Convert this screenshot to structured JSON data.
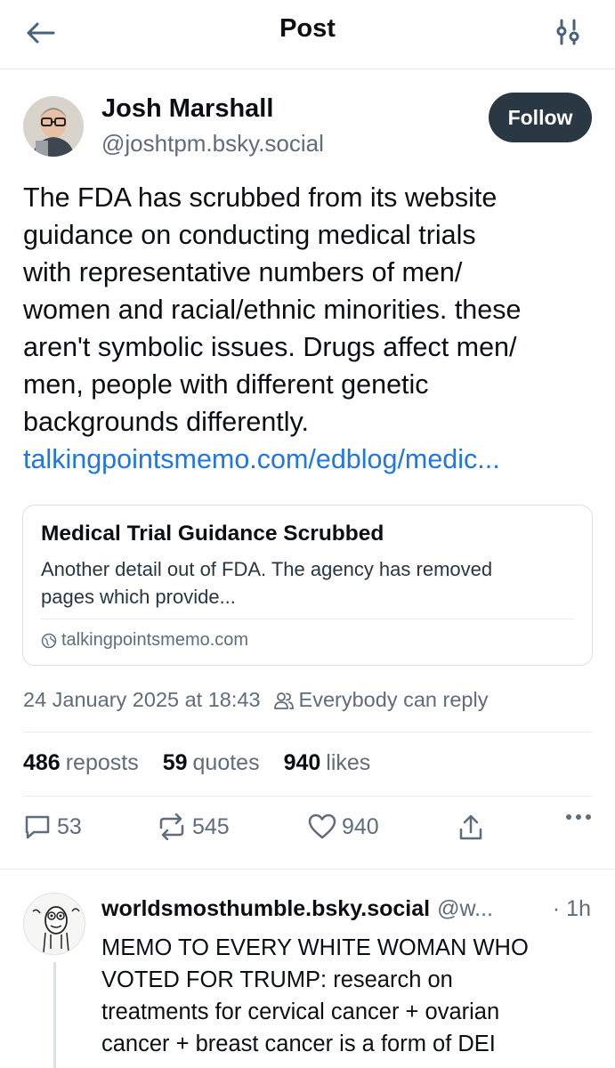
{
  "header": {
    "title": "Post"
  },
  "author": {
    "name": "Josh Marshall",
    "handle": "@joshtpm.bsky.social",
    "follow_label": "Follow"
  },
  "post": {
    "lines": [
      "The FDA has scrubbed from its website",
      "guidance on conducting medical trials",
      "with representative numbers of men/",
      "women and racial/ethnic minorities. these",
      "aren't symbolic issues. Drugs affect men/",
      "men, people with different genetic",
      "backgrounds differently."
    ],
    "link": "talkingpointsmemo.com/edblog/medic..."
  },
  "link_card": {
    "title": "Medical Trial Guidance Scrubbed",
    "desc_line1": "Another detail out of FDA. The agency has removed",
    "desc_line2": "pages which provide...",
    "domain": "talkingpointsmemo.com"
  },
  "meta": {
    "timestamp": "24 January 2025 at 18:43",
    "reply_setting": "Everybody can reply"
  },
  "stats": {
    "reposts_count": "486",
    "reposts_label": "reposts",
    "quotes_count": "59",
    "quotes_label": "quotes",
    "likes_count": "940",
    "likes_label": "likes"
  },
  "actions": {
    "replies": "53",
    "reposts": "545",
    "likes": "940"
  },
  "reply": {
    "name": "worldsmosthumble.bsky.social",
    "handle": "@w...",
    "time": "· 1h",
    "lines": [
      "MEMO TO EVERY WHITE WOMAN WHO",
      "VOTED FOR TRUMP: research on",
      "treatments for cervical cancer + ovarian",
      "cancer + breast cancer is a form of DEI"
    ]
  },
  "colors": {
    "link": "#1f77e0",
    "follow_bg": "#2a3844",
    "muted": "#5f6c7b"
  }
}
